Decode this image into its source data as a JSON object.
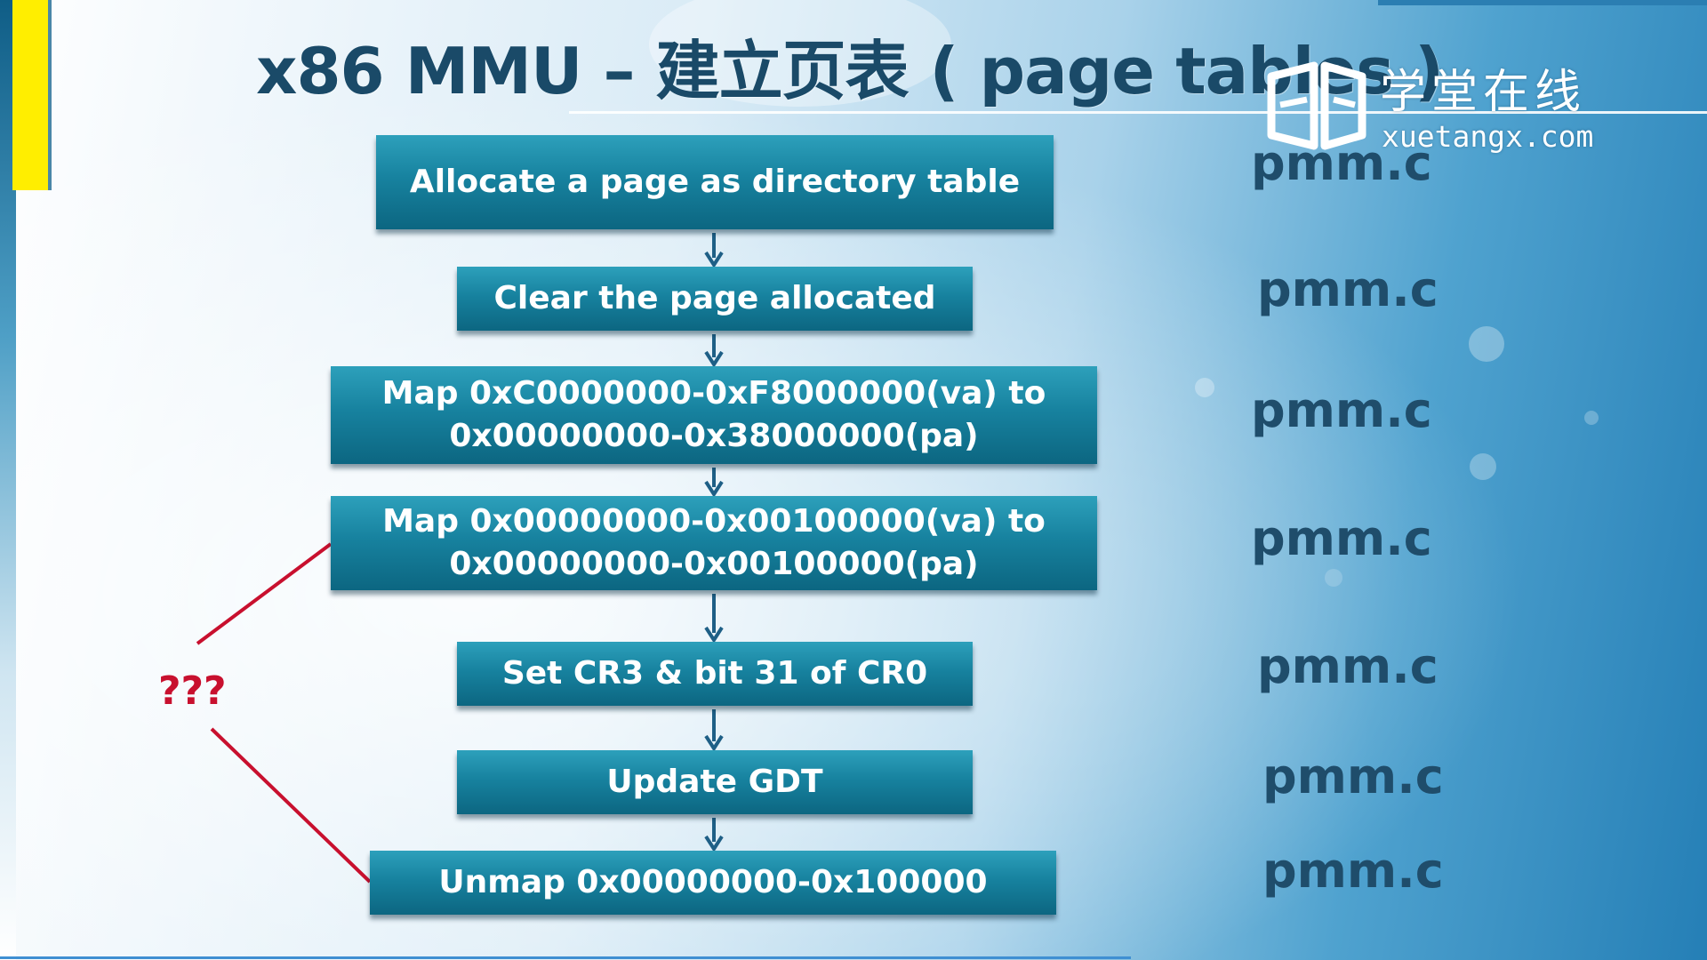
{
  "slide": {
    "title": "x86 MMU – 建立页表 ( page tables )",
    "watermark": {
      "text_cn": "学堂在线",
      "url": "xuetangx.com"
    }
  },
  "flow": {
    "steps": [
      {
        "id": "s1",
        "lines": [
          "Allocate a page as directory table"
        ],
        "file": "pmm.c"
      },
      {
        "id": "s2",
        "lines": [
          "Clear the page allocated"
        ],
        "file": "pmm.c"
      },
      {
        "id": "s3",
        "lines": [
          "Map 0xC0000000-0xF8000000(va) to",
          "0x00000000-0x38000000(pa)"
        ],
        "file": "pmm.c"
      },
      {
        "id": "s4",
        "lines": [
          "Map 0x00000000-0x00100000(va) to",
          "0x00000000-0x00100000(pa)"
        ],
        "file": "pmm.c"
      },
      {
        "id": "s5",
        "lines": [
          "Set CR3 & bit 31 of CR0"
        ],
        "file": "pmm.c"
      },
      {
        "id": "s6",
        "lines": [
          "Update GDT"
        ],
        "file": "pmm.c"
      },
      {
        "id": "s7",
        "lines": [
          "Unmap 0x00000000-0x100000"
        ],
        "file": "pmm.c"
      }
    ],
    "annotation": {
      "text": "???",
      "from_step": "s4",
      "to_step": "s7",
      "color": "#c8102e"
    }
  },
  "colors": {
    "box_top": "#2da0bb",
    "box_bottom": "#0c6681",
    "arrow": "#1e5f86",
    "title": "#1a4a68",
    "file_label": "#1f4d6b"
  }
}
